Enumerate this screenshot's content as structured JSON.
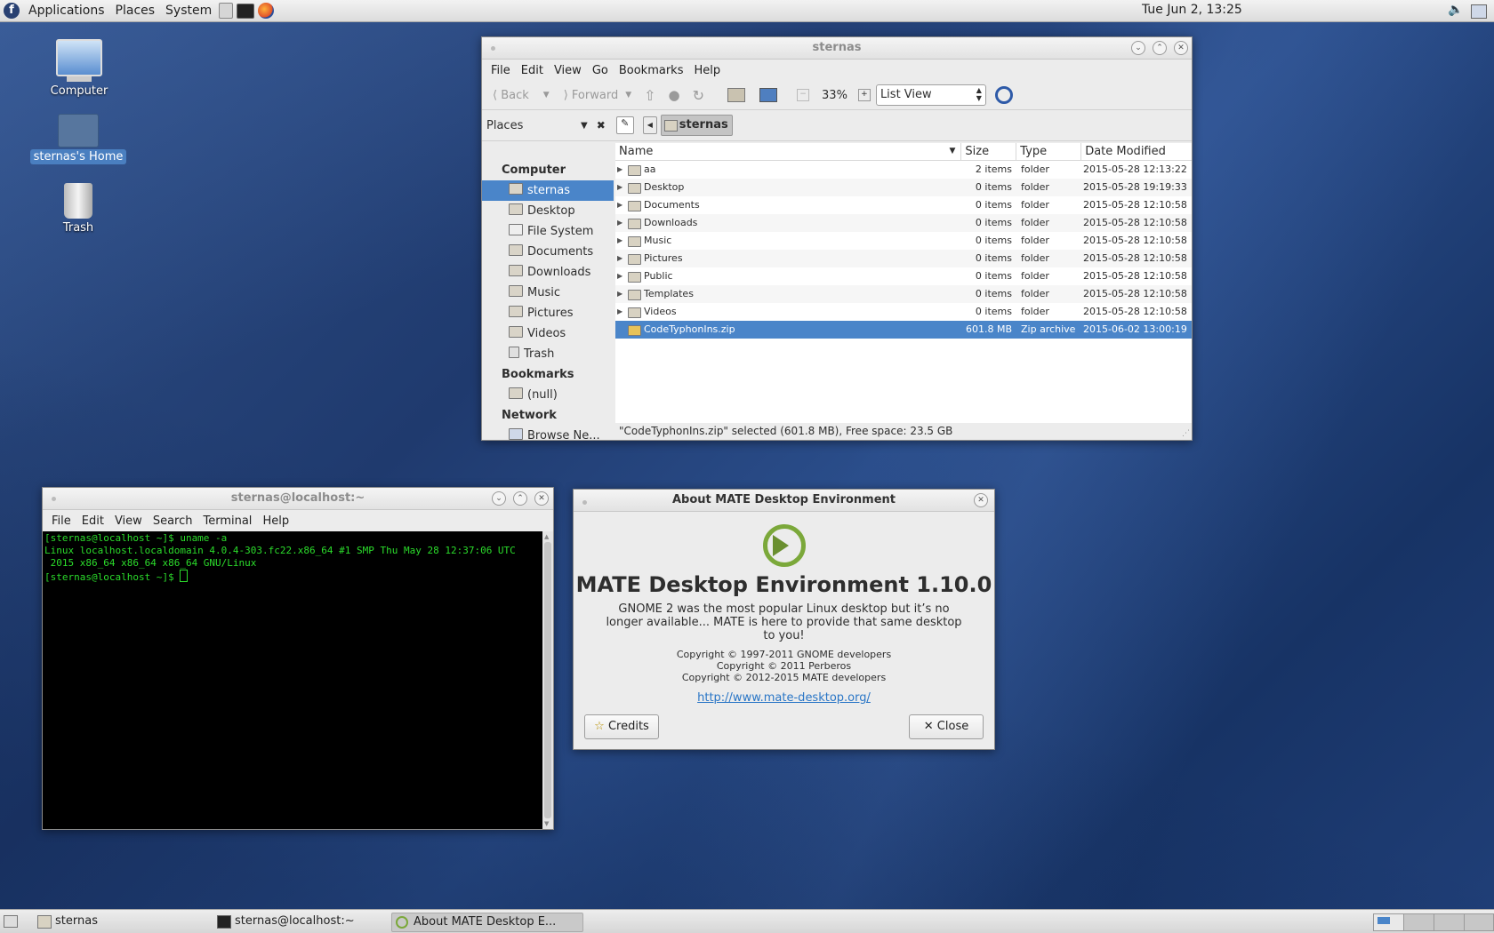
{
  "top_panel": {
    "menus": [
      "Applications",
      "Places",
      "System"
    ],
    "clock": "Tue Jun  2, 13:25"
  },
  "desktop": {
    "icons": [
      {
        "label": "Computer"
      },
      {
        "label": "sternas's Home"
      },
      {
        "label": "Trash"
      }
    ]
  },
  "file_manager": {
    "title": "sternas",
    "menu": [
      "File",
      "Edit",
      "View",
      "Go",
      "Bookmarks",
      "Help"
    ],
    "toolbar": {
      "back": "Back",
      "forward": "Forward",
      "zoom": "33%",
      "view_mode": "List View"
    },
    "sidebar": {
      "title": "Places",
      "sections": [
        {
          "header": "Computer",
          "items": [
            "sternas",
            "Desktop",
            "File System",
            "Documents",
            "Downloads",
            "Music",
            "Pictures",
            "Videos",
            "Trash"
          ]
        },
        {
          "header": "Bookmarks",
          "items": [
            "(null)"
          ]
        },
        {
          "header": "Network",
          "items": [
            "Browse Ne..."
          ]
        }
      ]
    },
    "path_button": "sternas",
    "columns": [
      "Name",
      "Size",
      "Type",
      "Date Modified"
    ],
    "rows": [
      {
        "name": "aa",
        "size": "2 items",
        "type": "folder",
        "date": "2015-05-28 12:13:22"
      },
      {
        "name": "Desktop",
        "size": "0 items",
        "type": "folder",
        "date": "2015-05-28 19:19:33"
      },
      {
        "name": "Documents",
        "size": "0 items",
        "type": "folder",
        "date": "2015-05-28 12:10:58"
      },
      {
        "name": "Downloads",
        "size": "0 items",
        "type": "folder",
        "date": "2015-05-28 12:10:58"
      },
      {
        "name": "Music",
        "size": "0 items",
        "type": "folder",
        "date": "2015-05-28 12:10:58"
      },
      {
        "name": "Pictures",
        "size": "0 items",
        "type": "folder",
        "date": "2015-05-28 12:10:58"
      },
      {
        "name": "Public",
        "size": "0 items",
        "type": "folder",
        "date": "2015-05-28 12:10:58"
      },
      {
        "name": "Templates",
        "size": "0 items",
        "type": "folder",
        "date": "2015-05-28 12:10:58"
      },
      {
        "name": "Videos",
        "size": "0 items",
        "type": "folder",
        "date": "2015-05-28 12:10:58"
      },
      {
        "name": "CodeTyphonIns.zip",
        "size": "601.8 MB",
        "type": "Zip archive",
        "date": "2015-06-02 13:00:19"
      }
    ],
    "status": "\"CodeTyphonIns.zip\" selected (601.8 MB), Free space: 23.5 GB"
  },
  "terminal": {
    "title": "sternas@localhost:~",
    "menu": [
      "File",
      "Edit",
      "View",
      "Search",
      "Terminal",
      "Help"
    ],
    "lines": [
      "[sternas@localhost ~]$ uname -a",
      "Linux localhost.localdomain 4.0.4-303.fc22.x86_64 #1 SMP Thu May 28 12:37:06 UTC",
      " 2015 x86_64 x86_64 x86_64 GNU/Linux",
      "[sternas@localhost ~]$ "
    ]
  },
  "about": {
    "title": "About MATE Desktop Environment",
    "heading": "MATE Desktop Environment 1.10.0",
    "desc_lines": [
      "GNOME 2 was the most popular Linux desktop but it’s no",
      "longer available... MATE is here to provide that same desktop",
      "to you!"
    ],
    "copyright": [
      "Copyright © 1997-2011 GNOME developers",
      "Copyright © 2011 Perberos",
      "Copyright © 2012-2015 MATE developers"
    ],
    "link": "http://www.mate-desktop.org/",
    "credits": "Credits",
    "close": "Close"
  },
  "taskbar": {
    "tasks": [
      "sternas",
      "sternas@localhost:~",
      "About MATE Desktop E..."
    ]
  }
}
